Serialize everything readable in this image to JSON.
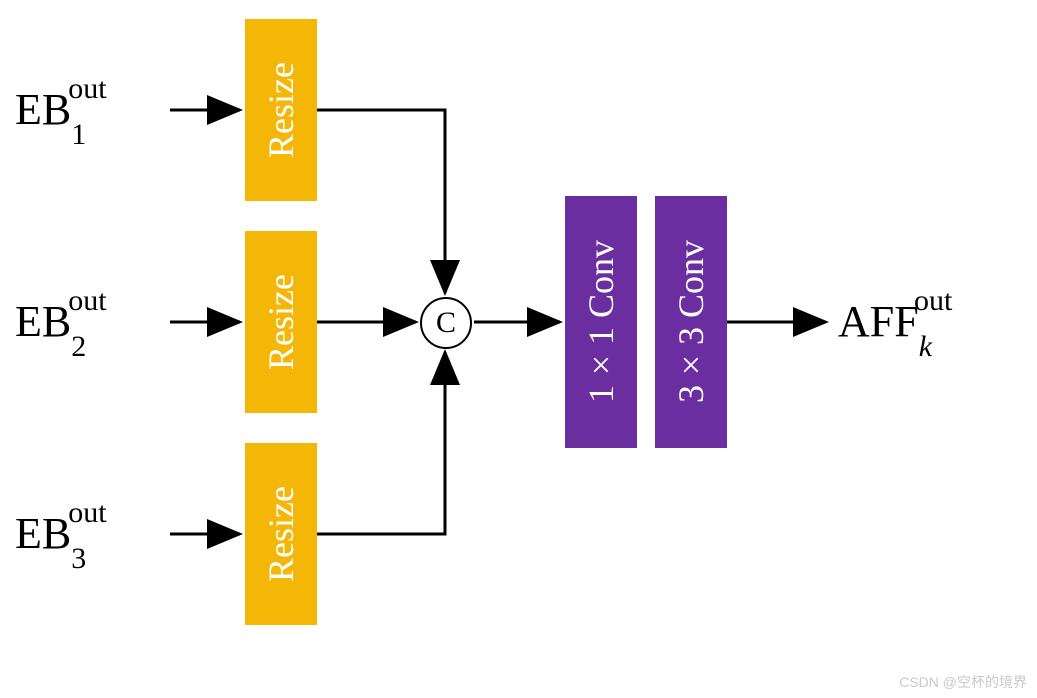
{
  "inputs": [
    {
      "base": "EB",
      "sub": "1",
      "sup": "out"
    },
    {
      "base": "EB",
      "sub": "2",
      "sup": "out"
    },
    {
      "base": "EB",
      "sub": "3",
      "sup": "out"
    }
  ],
  "resize_label": "Resize",
  "concat_symbol": "C",
  "conv_blocks": [
    {
      "label": "1×1 Conv"
    },
    {
      "label": "3×3 Conv"
    }
  ],
  "output": {
    "base": "AFF",
    "sub": "k",
    "sup": "out"
  },
  "colors": {
    "resize": "#f4b607",
    "conv": "#6b2ea0",
    "arrow": "#000000"
  },
  "watermark": "CSDN @空杯的境界"
}
